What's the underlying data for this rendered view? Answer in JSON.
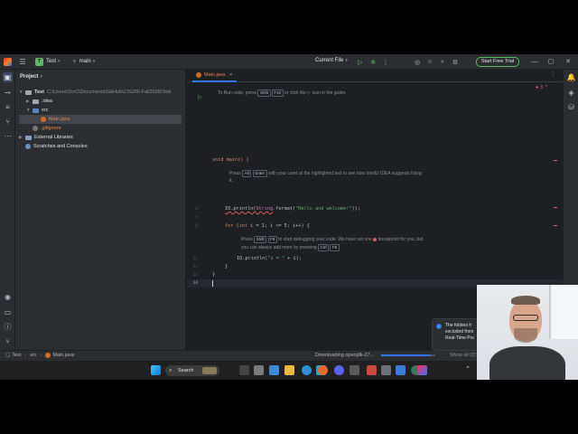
{
  "titlebar": {
    "project_badge": "T",
    "project_name": "Test",
    "branch": "main",
    "run_config": "Current File",
    "trial_button": "Start Free Trial",
    "icons": [
      "hamburger-icon",
      "branch-icon",
      "run-icon",
      "debug-icon",
      "more-icon",
      "coverage-icon",
      "user-icon",
      "search-icon",
      "settings-icon"
    ]
  },
  "project_panel": {
    "title": "Project",
    "tree": [
      {
        "label": "Test",
        "path": "C:\\Users\\SrcC\\Documents\\GitHub\\CIS296-Fall2028\\Test"
      },
      {
        "label": ".idea"
      },
      {
        "label": "src"
      },
      {
        "label": "Main.java"
      },
      {
        "label": ".gitignore"
      },
      {
        "label": "External Libraries"
      },
      {
        "label": "Scratches and Consoles"
      }
    ]
  },
  "editor": {
    "tab_label": "Main.java",
    "error_count": "3",
    "line_numbers": [
      "4",
      "5",
      "6",
      "7",
      "8",
      "9",
      "10",
      "11",
      "12",
      "13",
      "14"
    ],
    "hint_run_pre": "To Run code, press",
    "hint_run_key1": "Shift",
    "hint_run_key2": "F10",
    "hint_run_post": "or click the",
    "hint_run_end": "icon in the gutter.",
    "code_main": "void main() {",
    "hint_alt_pre": "Press",
    "hint_alt_key1": "Alt",
    "hint_alt_key2": "Enter",
    "hint_alt_post": "with your caret at the highlighted text to see how IntelliJ IDEA suggests fixing",
    "hint_alt_end": "it.",
    "code_println_a": "IO.println(",
    "code_println_b": "String",
    "code_println_c": ".format(",
    "code_println_d": "\"Hello and welcome!\"",
    "code_println_e": "));",
    "code_for_a": "for",
    "code_for_b": " (",
    "code_for_c": "int",
    "code_for_d": " i = 1; i <= 5; i++) {",
    "hint_dbg_pre": "Press",
    "hint_dbg_key1": "Shift",
    "hint_dbg_key2": "F9",
    "hint_dbg_post": "to start debugging your code. We have set one",
    "hint_dbg_end": "breakpoint for you, but",
    "hint_dbg_line2_pre": "you can always add more by pressing",
    "hint_dbg_key3": "Ctrl",
    "hint_dbg_key4": "F8",
    "code_inner_a": "IO.println(",
    "code_inner_b": "\"i = \"",
    "code_inner_c": " + i);",
    "code_close1": "}",
    "code_close2": "}"
  },
  "statusbar": {
    "breadcrumb_1": "Test",
    "breadcrumb_2": "src",
    "breadcrumb_3": "Main.java",
    "progress_text": "Downloading openjdk-27...",
    "progress": 0.92,
    "show_all": "Show all (2)"
  },
  "notification": {
    "text_1": "The folders h",
    "text_2": "excluded from",
    "text_3": "Real-Time Pro"
  },
  "taskbar": {
    "search_label": "Search"
  }
}
